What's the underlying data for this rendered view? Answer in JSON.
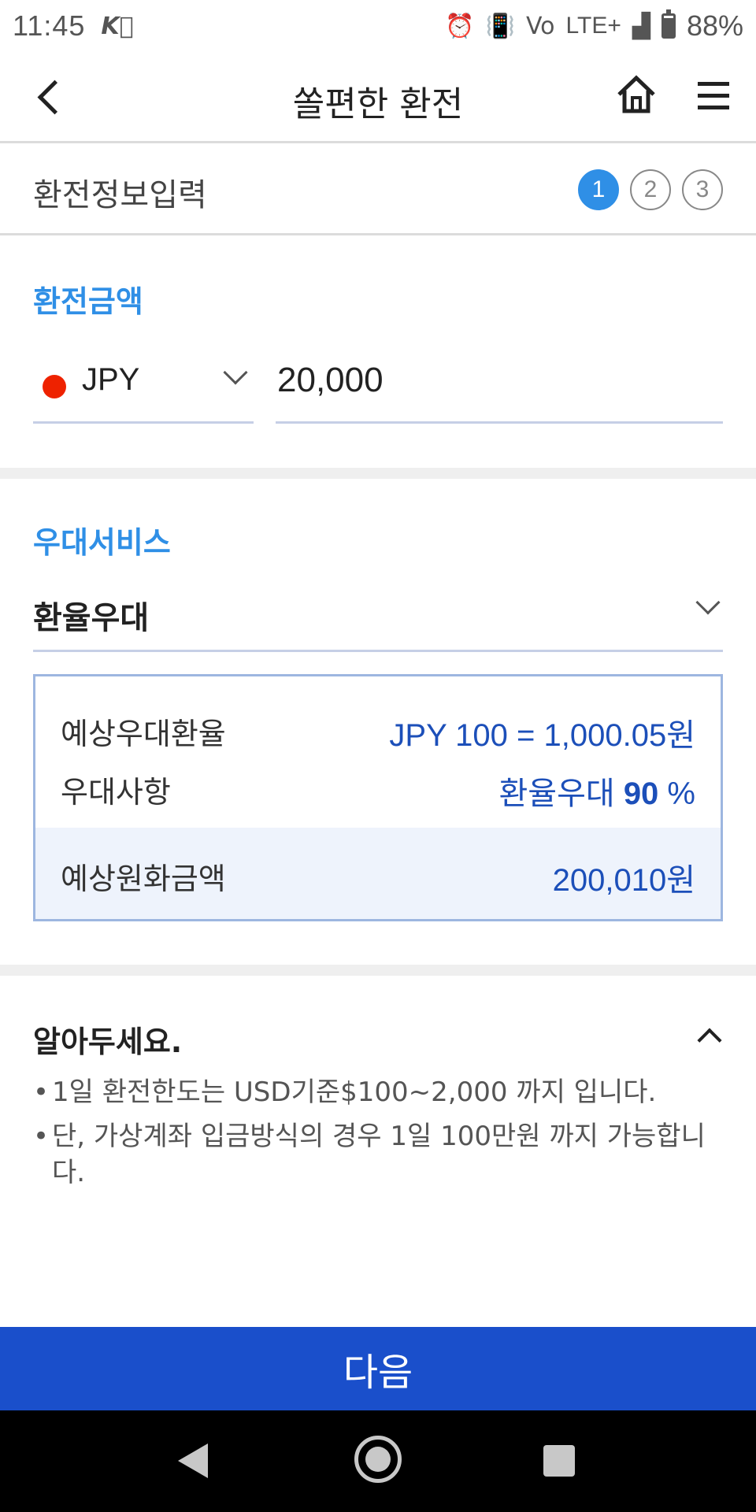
{
  "status_bar": {
    "time": "11:45",
    "network": "LTE+",
    "battery": "88%",
    "icons": [
      "vpn-key-icon",
      "alarm-icon",
      "vibrate-icon",
      "volte-icon",
      "signal-icon",
      "battery-icon"
    ]
  },
  "header": {
    "title": "쏠편한 환전"
  },
  "steps": {
    "title": "환전정보입력",
    "items": [
      "1",
      "2",
      "3"
    ],
    "active_index": 0
  },
  "amount_section": {
    "label": "환전금액",
    "currency": "JPY",
    "amount": "20,000"
  },
  "service_section": {
    "label": "우대서비스",
    "selected": "환율우대",
    "expected_rate_label": "예상우대환율",
    "expected_rate_value": "JPY 100 = 1,000.05원",
    "benefit_label": "우대사항",
    "benefit_prefix": "환율우대 ",
    "benefit_number": "90",
    "benefit_suffix": " %",
    "total_label": "예상원화금액",
    "total_value": "200,010원"
  },
  "notice": {
    "title": "알아두세요.",
    "items": [
      "1일 환전한도는 USD기준$100~2,000 까지 입니다.",
      "단, 가상계좌 입금방식의 경우 1일 100만원 까지 가능합니다."
    ]
  },
  "footer": {
    "next_label": "다음"
  },
  "colors": {
    "accent": "#2f8fe6",
    "primary_button": "#1a4fcb",
    "value_text": "#1c4fb9",
    "currency_dot": "#ee2200"
  }
}
